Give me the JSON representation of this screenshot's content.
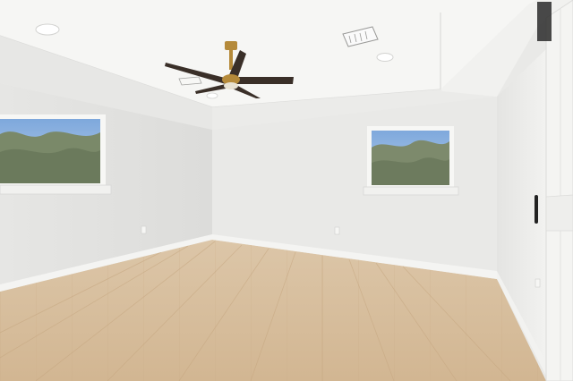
{
  "scene": {
    "kind": "empty interior room photo",
    "objects": [
      "tray-ceiling",
      "ceiling-fan",
      "hvac-vent",
      "recessed-light",
      "window-left",
      "window-back",
      "barn-door",
      "door-handle",
      "laminate-floor",
      "baseboard",
      "electrical-outlet"
    ]
  },
  "colors": {
    "ceiling": "#f3f3f1",
    "wall_left": "#e4e4e2",
    "wall_back": "#e9e9e7",
    "wall_right": "#efefed",
    "floor": "#d8bfa0",
    "fan_blade": "#3a2f28",
    "fan_brass": "#b58a3a",
    "sky": "#8fb4e0",
    "trees": "#7d8a6c",
    "hardware": "#222222"
  }
}
